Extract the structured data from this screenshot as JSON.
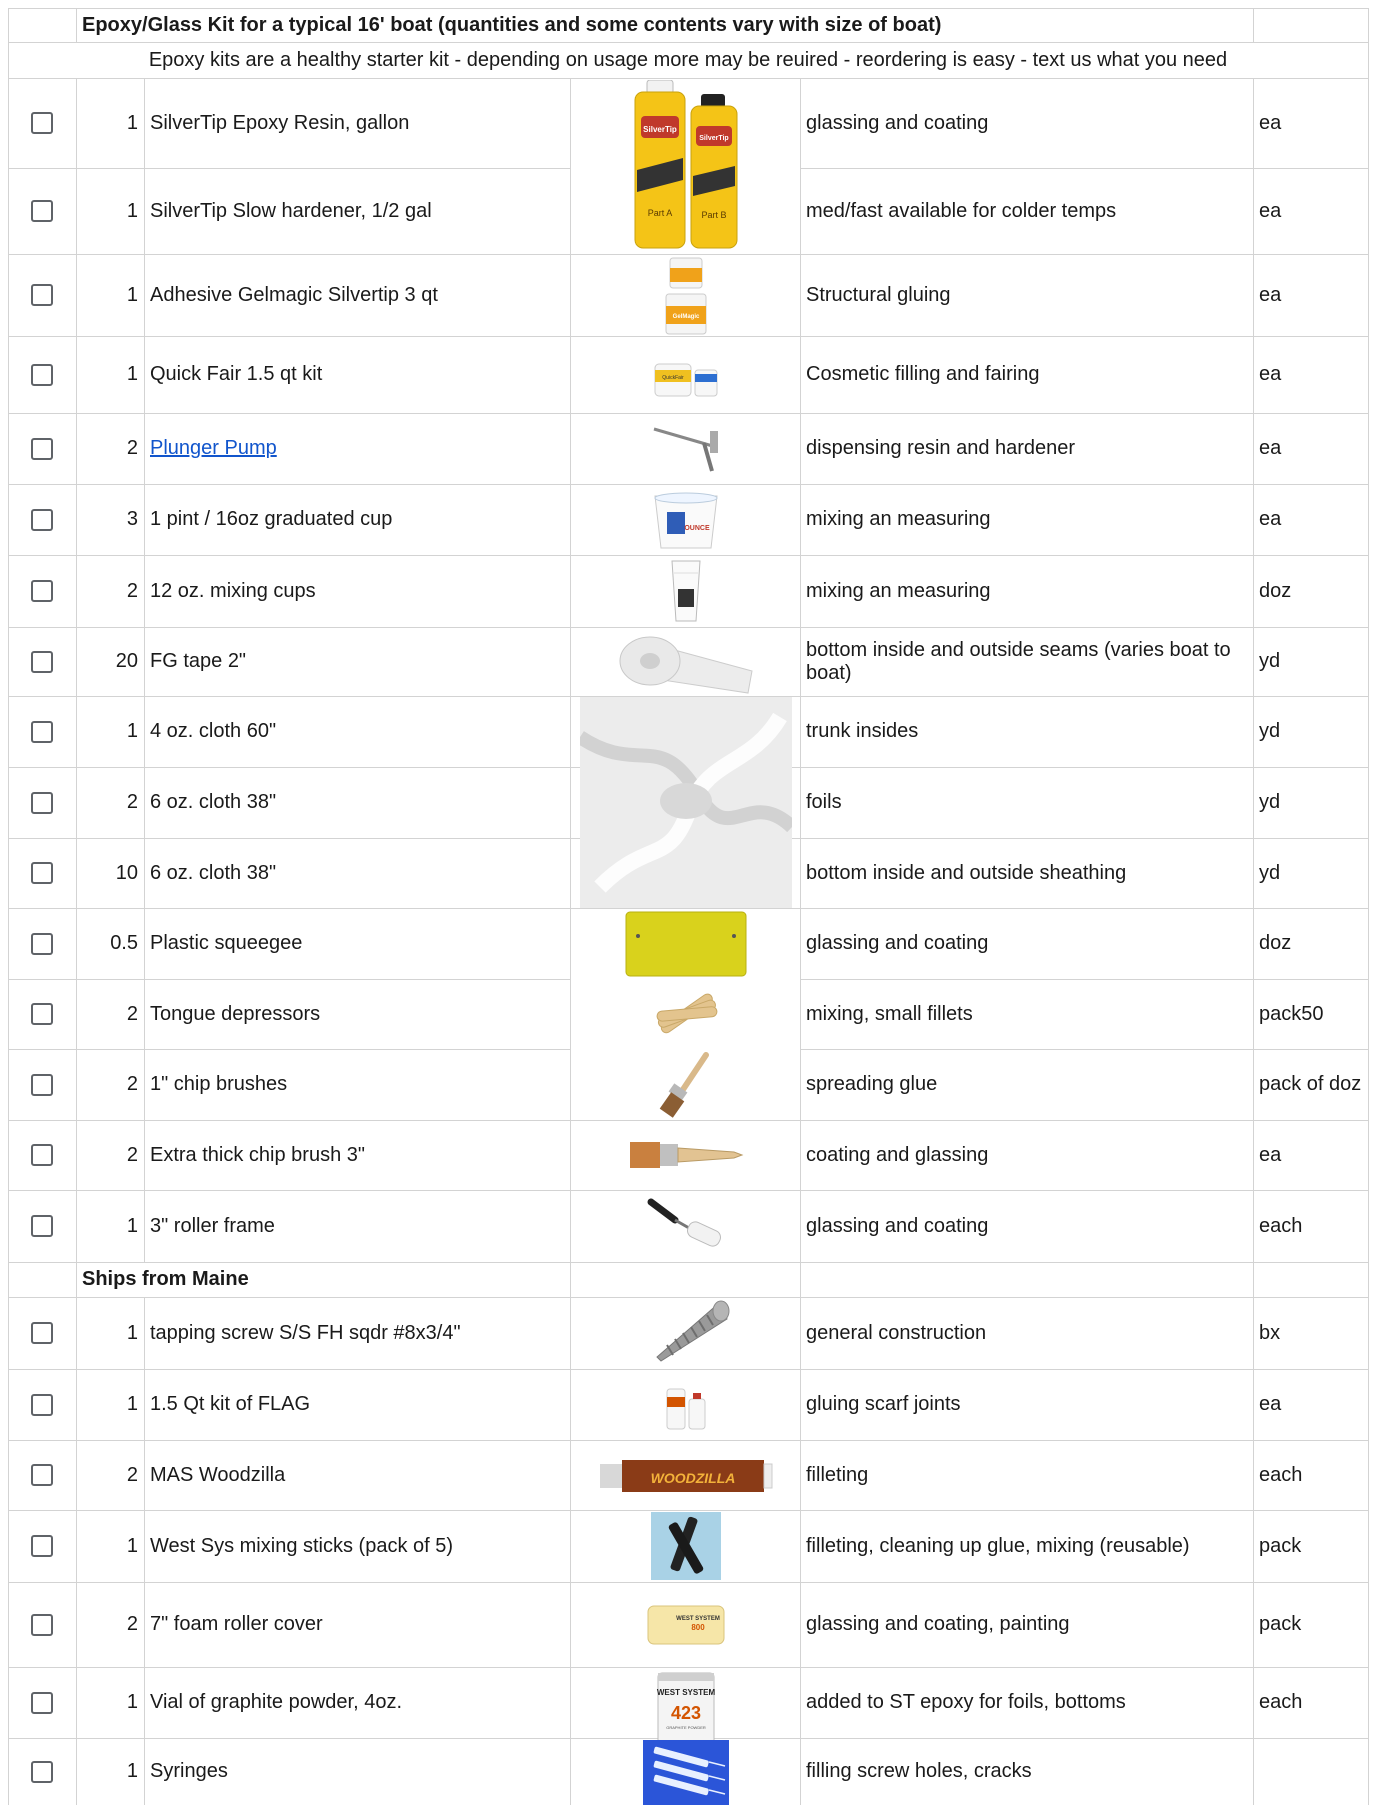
{
  "title": "Epoxy/Glass Kit for a typical 16' boat (quantities and some contents vary with size of boat)",
  "note": "Epoxy kits are a healthy starter kit - depending on usage more may be reuired - reordering is easy - text us what you need",
  "section_ships": "Ships from Maine",
  "rows": [
    {
      "qty": "1",
      "item": "SilverTip Epoxy Resin, gallon",
      "desc": "glassing and coating",
      "unit": "ea"
    },
    {
      "qty": "1",
      "item": "SilverTip Slow hardener, 1/2 gal",
      "desc": "med/fast available for colder temps",
      "unit": "ea"
    },
    {
      "qty": "1",
      "item": "Adhesive Gelmagic Silvertip 3 qt",
      "desc": "Structural gluing",
      "unit": "ea"
    },
    {
      "qty": "1",
      "item": "Quick Fair 1.5 qt kit",
      "desc": "Cosmetic filling and fairing",
      "unit": "ea"
    },
    {
      "qty": "2",
      "item": "Plunger Pump",
      "desc": "dispensing resin and hardener",
      "unit": "ea",
      "link": true
    },
    {
      "qty": "3",
      "item": "1 pint / 16oz graduated cup",
      "desc": "mixing an measuring",
      "unit": "ea"
    },
    {
      "qty": "2",
      "item": "12 oz. mixing cups",
      "desc": "mixing an measuring",
      "unit": "doz"
    },
    {
      "qty": "20",
      "item": "FG tape 2\"",
      "desc": "bottom inside and outside seams (varies boat to boat)",
      "unit": "yd"
    },
    {
      "qty": "1",
      "item": "4 oz. cloth 60\"",
      "desc": "trunk insides",
      "unit": "yd"
    },
    {
      "qty": "2",
      "item": "6 oz. cloth 38\"",
      "desc": "foils",
      "unit": "yd"
    },
    {
      "qty": "10",
      "item": "6 oz. cloth 38\"",
      "desc": "bottom inside and outside sheathing",
      "unit": "yd"
    },
    {
      "qty": "0.5",
      "item": "Plastic squeegee",
      "desc": "glassing and coating",
      "unit": "doz"
    },
    {
      "qty": "2",
      "item": "Tongue depressors",
      "desc": "mixing, small fillets",
      "unit": "pack50"
    },
    {
      "qty": "2",
      "item": "1\" chip brushes",
      "desc": "spreading glue",
      "unit": "pack of doz"
    },
    {
      "qty": "2",
      "item": "Extra thick chip brush 3\"",
      "desc": "coating and glassing",
      "unit": "ea"
    },
    {
      "qty": "1",
      "item": "3\" roller frame",
      "desc": "glassing and coating",
      "unit": "each"
    },
    {
      "qty": "1",
      "item": "tapping screw S/S FH sqdr #8x3/4\"",
      "desc": "general construction",
      "unit": "bx"
    },
    {
      "qty": "1",
      "item": "1.5 Qt kit of FLAG",
      "desc": "gluing scarf joints",
      "unit": "ea"
    },
    {
      "qty": "2",
      "item": "MAS Woodzilla",
      "desc": "filleting",
      "unit": "each"
    },
    {
      "qty": "1",
      "item": "West Sys mixing sticks (pack of 5)",
      "desc": "filleting, cleaning up glue, mixing (reusable)",
      "unit": "pack"
    },
    {
      "qty": "2",
      "item": "7\" foam roller cover",
      "desc": "glassing and coating, painting",
      "unit": "pack"
    },
    {
      "qty": "1",
      "item": "Vial of graphite powder, 4oz.",
      "desc": "added to ST epoxy for foils, bottoms",
      "unit": "each"
    },
    {
      "qty": "1",
      "item": "Syringes",
      "desc": "filling screw holes, cracks",
      "unit": ""
    }
  ],
  "images": {
    "silvertip": {
      "name": "silvertip-epoxy-image",
      "brand": "SilverTip",
      "sub": "EPOXY",
      "partA": "Part A",
      "partB": "Part B"
    },
    "gelmagic": {
      "name": "gelmagic-tubs-image",
      "label": "GelMagic"
    },
    "quickfair": {
      "name": "quick-fair-image",
      "label": "QuickFair"
    },
    "pump": {
      "name": "plunger-pump-image"
    },
    "gradcup": {
      "name": "graduated-cup-image",
      "label": "OUNCE"
    },
    "mixcups": {
      "name": "mixing-cups-image"
    },
    "tape": {
      "name": "fg-tape-image"
    },
    "cloth": {
      "name": "fiberglass-cloth-image"
    },
    "squeegee": {
      "name": "squeegee-image"
    },
    "tongue": {
      "name": "tongue-depressors-image"
    },
    "brush1": {
      "name": "chip-brush-image"
    },
    "brush3": {
      "name": "thick-chip-brush-image"
    },
    "roller": {
      "name": "roller-frame-image"
    },
    "screw": {
      "name": "tapping-screw-image"
    },
    "flag": {
      "name": "flag-kit-image"
    },
    "woodzilla": {
      "name": "woodzilla-tube-image",
      "label": "WOODZILLA"
    },
    "sticks": {
      "name": "mixing-sticks-image"
    },
    "foamroll": {
      "name": "foam-roller-cover-image",
      "brand": "WEST SYSTEM",
      "num": "800"
    },
    "graphite": {
      "name": "graphite-powder-image",
      "brand": "WEST SYSTEM",
      "num": "423",
      "sub": "GRAPHITE POWDER"
    },
    "syringes": {
      "name": "syringes-image"
    }
  },
  "colors": {
    "grid": "#d3d3d3",
    "link": "#1155cc",
    "checkbox": "#5f6368",
    "label_yellow": "#f4c417",
    "squeegee": "#d9d21c",
    "tongue": "#e3c48e",
    "cloth": "#ececec",
    "sticks_bg": "#a9d2e6",
    "syringe_bg": "#2b55d8"
  }
}
